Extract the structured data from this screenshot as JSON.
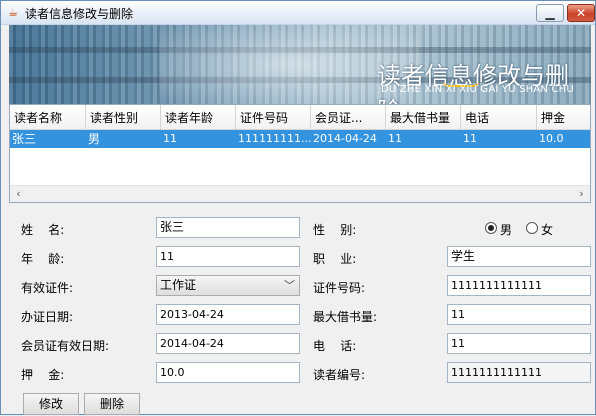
{
  "window": {
    "title": "读者信息修改与删除"
  },
  "banner": {
    "title": "读者信息修改与删除",
    "subtitle": "DU ZHE  XIN XI XIU GAI YU SHAN CHU"
  },
  "table": {
    "columns": [
      "读者名称",
      "读者性别",
      "读者年龄",
      "证件号码",
      "会员证...",
      "最大借书量",
      "电话",
      "押金"
    ],
    "rows": [
      [
        "张三",
        "男",
        "11",
        "111111111...",
        "2014-04-24",
        "11",
        "11",
        "10.0"
      ]
    ]
  },
  "form": {
    "name_label": "姓    名:",
    "name_value": "张三",
    "gender_label": "性    别:",
    "gender_options": [
      "男",
      "女"
    ],
    "gender_selected": "男",
    "age_label": "年    龄:",
    "age_value": "11",
    "job_label": "职    业:",
    "job_value": "学生",
    "idtype_label": "有效证件:",
    "idtype_value": "工作证",
    "idno_label": "证件号码:",
    "idno_value": "1111111111111",
    "issue_label": "办证日期:",
    "issue_value": "2013-04-24",
    "maxborrow_label": "最大借书量:",
    "maxborrow_value": "11",
    "valid_label": "会员证有效日期:",
    "valid_value": "2014-04-24",
    "phone_label": "电    话:",
    "phone_value": "11",
    "deposit_label": "押    金:",
    "deposit_value": "10.0",
    "readerno_label": "读者编号:",
    "readerno_value": "1111111111111"
  },
  "buttons": {
    "modify": "修改",
    "delete": "删除"
  }
}
